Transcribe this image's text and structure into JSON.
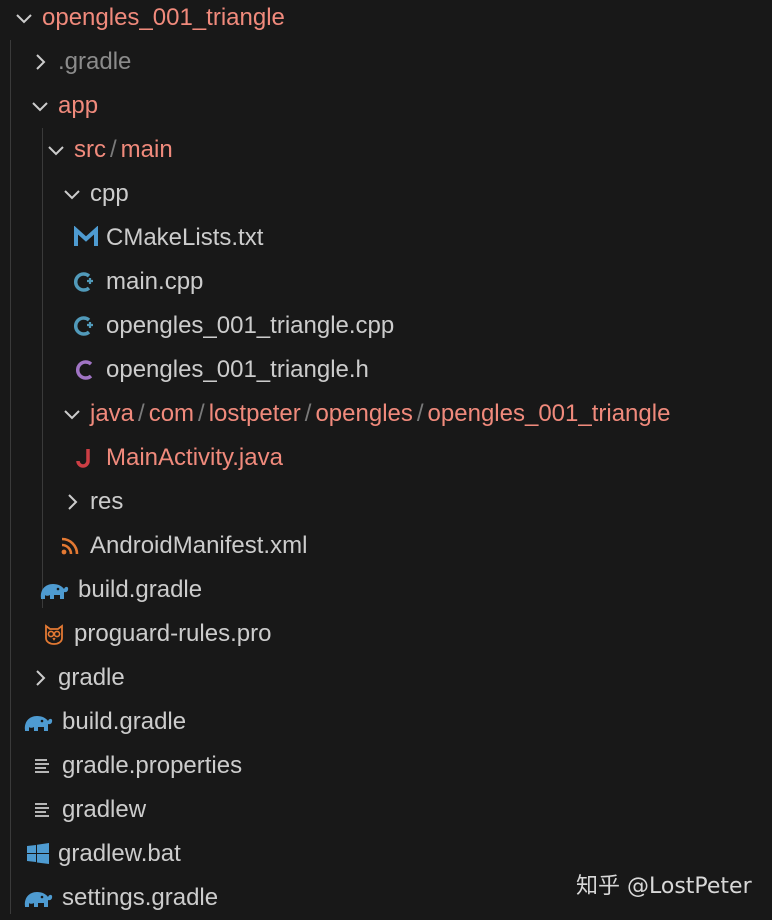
{
  "colors": {
    "background": "#181818",
    "git_modified": "#f08a7c",
    "text": "#cccccc",
    "ignored": "#8b8b8b",
    "cmake_icon": "#4e9bd1",
    "cpp_icon": "#519aba",
    "c_icon": "#a074c4",
    "java_icon": "#cc3e44",
    "xml_icon": "#e37933",
    "gradle_icon": "#4e9bd1",
    "proguard_icon": "#e37933",
    "windows_icon": "#4e9bd1"
  },
  "explorer": {
    "items": [
      {
        "label": "opengles_001_triangle",
        "icon": "chevron-down-icon",
        "kind": "folder-open"
      },
      {
        "label": ".gradle",
        "icon": "chevron-right-icon",
        "kind": "folder-closed"
      },
      {
        "label": "app",
        "icon": "chevron-down-icon",
        "kind": "folder-open"
      },
      {
        "segments": [
          "src",
          "main"
        ],
        "icon": "chevron-down-icon",
        "kind": "folder-open"
      },
      {
        "label": "cpp",
        "icon": "chevron-down-icon",
        "kind": "folder-open"
      },
      {
        "label": "CMakeLists.txt",
        "icon": "cmake-icon",
        "kind": "file"
      },
      {
        "label": "main.cpp",
        "icon": "cpp-file-icon",
        "kind": "file"
      },
      {
        "label": "opengles_001_triangle.cpp",
        "icon": "cpp-file-icon",
        "kind": "file"
      },
      {
        "label": "opengles_001_triangle.h",
        "icon": "c-header-icon",
        "kind": "file"
      },
      {
        "segments": [
          "java",
          "com",
          "lostpeter",
          "opengles",
          "opengles_001_triangle"
        ],
        "icon": "chevron-down-icon",
        "kind": "folder-open"
      },
      {
        "label": "MainActivity.java",
        "icon": "java-file-icon",
        "kind": "file"
      },
      {
        "label": "res",
        "icon": "chevron-right-icon",
        "kind": "folder-closed"
      },
      {
        "label": "AndroidManifest.xml",
        "icon": "rss-xml-icon",
        "kind": "file"
      },
      {
        "label": "build.gradle",
        "icon": "gradle-elephant-icon",
        "kind": "file"
      },
      {
        "label": "proguard-rules.pro",
        "icon": "owl-icon",
        "kind": "file"
      },
      {
        "label": "gradle",
        "icon": "chevron-right-icon",
        "kind": "folder-closed"
      },
      {
        "label": "build.gradle",
        "icon": "gradle-elephant-icon",
        "kind": "file"
      },
      {
        "label": "gradle.properties",
        "icon": "lines-icon",
        "kind": "file"
      },
      {
        "label": "gradlew",
        "icon": "lines-icon",
        "kind": "file"
      },
      {
        "label": "gradlew.bat",
        "icon": "windows-icon",
        "kind": "file"
      },
      {
        "label": "settings.gradle",
        "icon": "gradle-elephant-icon",
        "kind": "file"
      }
    ]
  },
  "watermark": "知乎 @LostPeter"
}
